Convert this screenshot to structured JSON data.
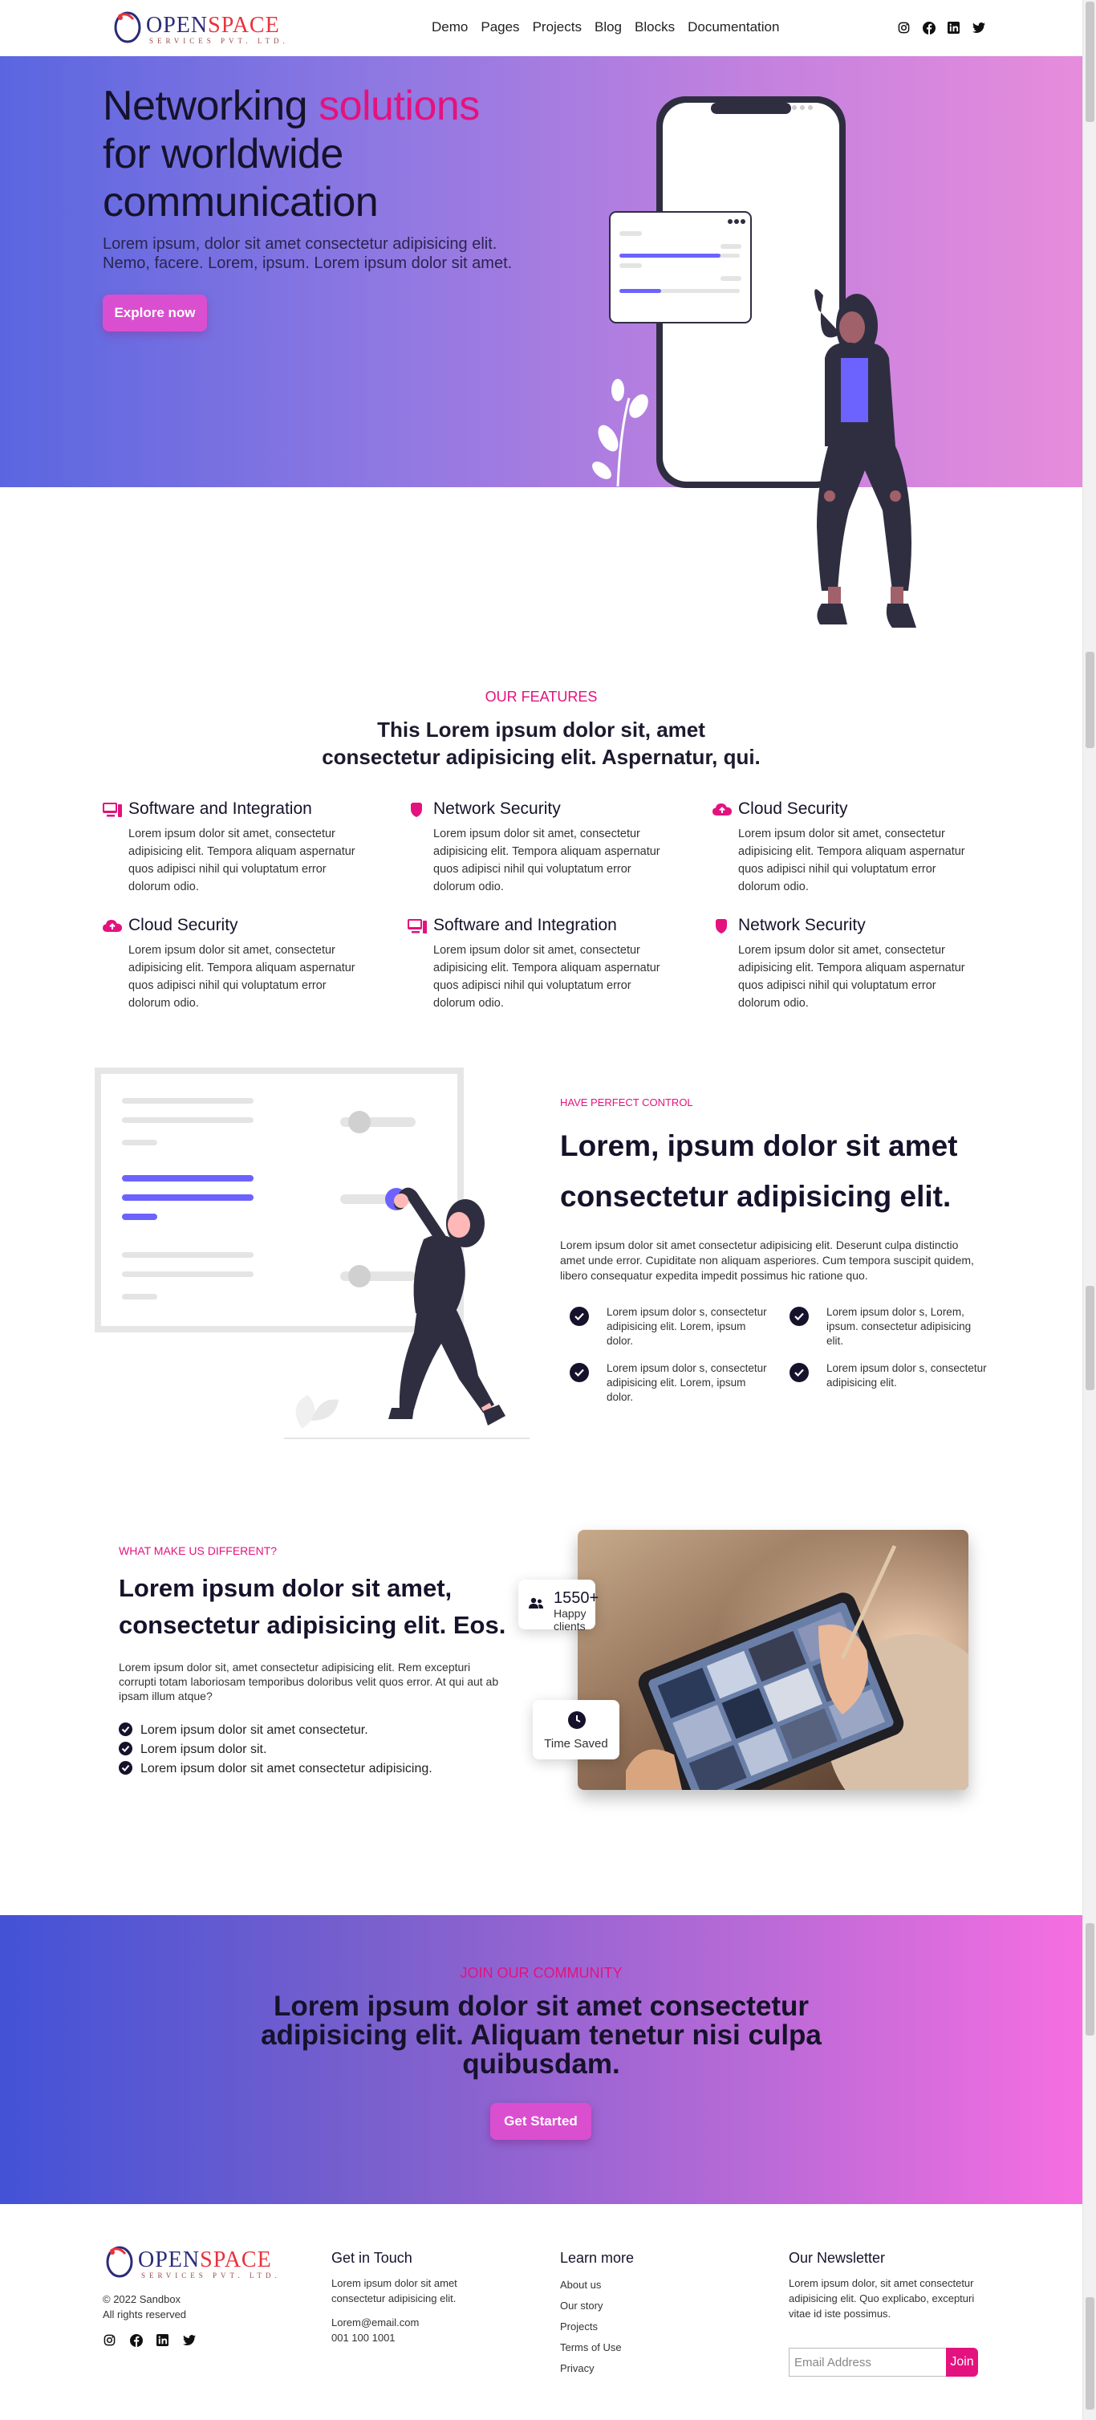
{
  "brand": {
    "name_part1": "OPEN",
    "name_part2": "SPACE",
    "subtitle": "SERVICES PVT. LTD."
  },
  "nav": {
    "links": [
      "Demo",
      "Pages",
      "Projects",
      "Blog",
      "Blocks",
      "Documentation"
    ]
  },
  "social_icons": [
    "instagram-icon",
    "facebook-icon",
    "linkedin-icon",
    "twitter-icon"
  ],
  "hero": {
    "title_part1": "Networking ",
    "title_highlight": "solutions",
    "title_part2": "for worldwide communication",
    "text": "Lorem ipsum, dolor sit amet consectetur adipisicing elit. Nemo, facere. Lorem, ipsum. Lorem ipsum dolor sit amet.",
    "button": "Explore now"
  },
  "features": {
    "kicker": "OUR FEATURES",
    "title": "This Lorem ipsum dolor sit, amet consectetur adipisicing elit. Aspernatur, qui.",
    "items": [
      {
        "icon": "computer-icon",
        "title": "Software and Integration",
        "text": "Lorem ipsum dolor sit amet, consectetur adipisicing elit. Tempora aliquam aspernatur quos adipisci nihil qui voluptatum error dolorum odio."
      },
      {
        "icon": "shield-icon",
        "title": "Network Security",
        "text": "Lorem ipsum dolor sit amet, consectetur adipisicing elit. Tempora aliquam aspernatur quos adipisci nihil qui voluptatum error dolorum odio."
      },
      {
        "icon": "cloud-upload-icon",
        "title": "Cloud Security",
        "text": "Lorem ipsum dolor sit amet, consectetur adipisicing elit. Tempora aliquam aspernatur quos adipisci nihil qui voluptatum error dolorum odio."
      },
      {
        "icon": "cloud-upload-icon",
        "title": "Cloud Security",
        "text": "Lorem ipsum dolor sit amet, consectetur adipisicing elit. Tempora aliquam aspernatur quos adipisci nihil qui voluptatum error dolorum odio."
      },
      {
        "icon": "computer-icon",
        "title": "Software and Integration",
        "text": "Lorem ipsum dolor sit amet, consectetur adipisicing elit. Tempora aliquam aspernatur quos adipisci nihil qui voluptatum error dolorum odio."
      },
      {
        "icon": "shield-icon",
        "title": "Network Security",
        "text": "Lorem ipsum dolor sit amet, consectetur adipisicing elit. Tempora aliquam aspernatur quos adipisci nihil qui voluptatum error dolorum odio."
      }
    ]
  },
  "control": {
    "kicker": "HAVE PERFECT CONTROL",
    "title": "Lorem, ipsum dolor sit amet consectetur adipisicing elit.",
    "text": "Lorem ipsum dolor sit amet consectetur adipisicing elit. Deserunt culpa distinctio amet unde error. Cupiditate non aliquam asperiores. Cum tempora suscipit quidem, libero consequatur expedita impedit possimus hic ratione quo.",
    "checks": [
      "Lorem ipsum dolor s, consectetur adipisicing elit. Lorem, ipsum dolor.",
      "Lorem ipsum dolor s, Lorem, ipsum. consectetur adipisicing elit.",
      "Lorem ipsum dolor s, consectetur adipisicing elit. Lorem, ipsum dolor.",
      "Lorem ipsum dolor s, consectetur adipisicing elit."
    ]
  },
  "different": {
    "kicker": "WHAT MAKE US DIFFERENT?",
    "title": "Lorem ipsum dolor sit amet, consectetur adipisicing elit. Eos.",
    "text": "Lorem ipsum dolor sit, amet consectetur adipisicing elit. Rem excepturi corrupti totam laboriosam temporibus doloribus velit quos error. At qui aut ab ipsam illum atque?",
    "bullets": [
      "Lorem ipsum dolor sit amet consectetur.",
      "Lorem ipsum dolor sit.",
      "Lorem ipsum dolor sit amet consectetur adipisicing."
    ],
    "stat1": {
      "value": "1550+",
      "label": "Happy clients",
      "icon": "users-icon"
    },
    "stat2": {
      "label": "Time Saved",
      "icon": "clock-icon"
    }
  },
  "community": {
    "kicker": "JOIN OUR COMMUNITY",
    "title": "Lorem ipsum dolor sit amet consectetur adipisicing elit. Aliquam tenetur nisi culpa quibusdam.",
    "button": "Get Started"
  },
  "footer": {
    "copyright": "© 2022 Sandbox",
    "rights": "All rights reserved",
    "contact": {
      "heading": "Get in Touch",
      "text": "Lorem ipsum dolor sit amet consectetur adipisicing elit.",
      "email": "Lorem@email.com",
      "phone": "001 100 1001"
    },
    "learn": {
      "heading": "Learn more",
      "links": [
        "About us",
        "Our story",
        "Projects",
        "Terms of Use",
        "Privacy"
      ]
    },
    "newsletter": {
      "heading": "Our Newsletter",
      "text": "Lorem ipsum dolor, sit amet consectetur adipisicing elit. Quo explicabo, excepturi vitae id iste possimus.",
      "placeholder": "Email Address",
      "button": "Join"
    }
  },
  "colors": {
    "accent": "#e4127e",
    "dark": "#16122b",
    "button": "#da4fcf",
    "purple": "#6c63ff"
  }
}
